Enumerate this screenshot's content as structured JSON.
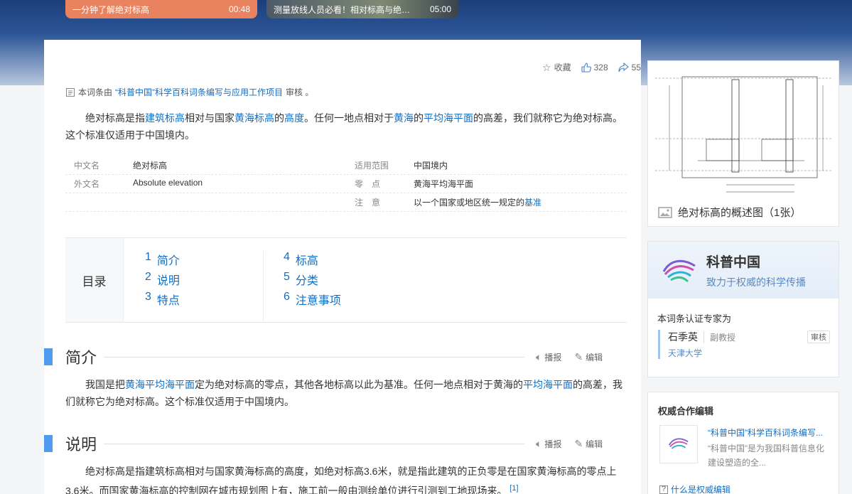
{
  "videos": [
    {
      "title": "一分钟了解绝对标高",
      "duration": "00:48"
    },
    {
      "title": "测量放线人员必看！相对标高与绝对...",
      "duration": "05:00"
    }
  ],
  "actions": {
    "collect": "收藏",
    "likes": "328",
    "shares": "55"
  },
  "review_note": {
    "prefix": "本词条由",
    "link": "“科普中国”科学百科词条编写与应用工作项目",
    "suffix": "审核 。"
  },
  "lead": {
    "t1": "绝对标高是指",
    "l1": "建筑标高",
    "t2": "相对与国家",
    "l2": "黄海标高",
    "t3": "的",
    "l3": "高度",
    "t4": "。任何一地点相对于",
    "l4": "黄海",
    "t5": "的",
    "l5": "平均海平面",
    "t6": "的高差，我们就称它为绝对标高。这个标准仅适用于中国境内。"
  },
  "infobox": {
    "r1": {
      "k1": "中文名",
      "v1": "绝对标高",
      "k2": "适用范围",
      "v2": "中国境内"
    },
    "r2": {
      "k1": "外文名",
      "v1": "Absolute elevation",
      "k2": "零　点",
      "v2": "黄海平均海平面"
    },
    "r3": {
      "k2": "注　意",
      "v2": "以一个国家或地区统一规定的",
      "v2link": "基准"
    }
  },
  "toc": {
    "title": "目录",
    "items": [
      {
        "n": "1",
        "label": "简介"
      },
      {
        "n": "2",
        "label": "说明"
      },
      {
        "n": "3",
        "label": "特点"
      },
      {
        "n": "4",
        "label": "标高"
      },
      {
        "n": "5",
        "label": "分类"
      },
      {
        "n": "6",
        "label": "注意事项"
      }
    ]
  },
  "ops": {
    "report": "播报",
    "edit": "编辑"
  },
  "sections": {
    "intro": {
      "title": "简介",
      "p1": "我国是把",
      "l1": "黄海平均海平面",
      "p2": "定为绝对标高的零点，其他各地标高以此为基准。任何一地点相对于黄海的",
      "l2": "平均海平面",
      "p3": "的高差，我们就称它为绝对标高。这个标准仅适用于中国境内。"
    },
    "explain": {
      "title": "说明",
      "p": "绝对标高是指建筑标高相对与国家黄海标高的高度，如绝对标高3.6米，就是指此建筑的正负零是在国家黄海标高的零点上3.6米。而国家黄海标高的控制网在城市规划图上有，施工前一般由测绘单位进行引测到工地现场来。",
      "ref": "[1]"
    }
  },
  "album": {
    "caption": "绝对标高的概述图（1张）"
  },
  "kepu": {
    "name": "科普中国",
    "slogan": "致力于权威的科学传播",
    "expert_title": "本词条认证专家为",
    "expert": {
      "name": "石季英",
      "title": "副教授",
      "tag": "审核",
      "org": "天津大学"
    }
  },
  "coop": {
    "title": "权威合作编辑",
    "name": "“科普中国”科学百科词条编写...",
    "desc": "“科普中国”是为我国科普信息化建设塑造的全...",
    "what": "什么是权威编辑"
  },
  "colors": {
    "accent": "#4f9cee",
    "link": "#136ec2"
  }
}
